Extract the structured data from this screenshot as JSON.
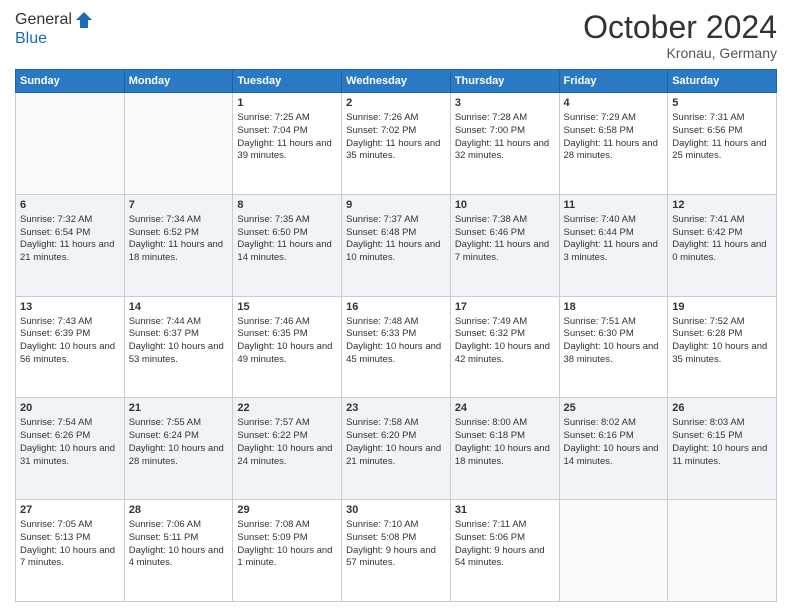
{
  "header": {
    "logo_line1": "General",
    "logo_line2": "Blue",
    "month": "October 2024",
    "location": "Kronau, Germany"
  },
  "days_of_week": [
    "Sunday",
    "Monday",
    "Tuesday",
    "Wednesday",
    "Thursday",
    "Friday",
    "Saturday"
  ],
  "weeks": [
    [
      {
        "day": "",
        "sunrise": "",
        "sunset": "",
        "daylight": ""
      },
      {
        "day": "",
        "sunrise": "",
        "sunset": "",
        "daylight": ""
      },
      {
        "day": "1",
        "sunrise": "Sunrise: 7:25 AM",
        "sunset": "Sunset: 7:04 PM",
        "daylight": "Daylight: 11 hours and 39 minutes."
      },
      {
        "day": "2",
        "sunrise": "Sunrise: 7:26 AM",
        "sunset": "Sunset: 7:02 PM",
        "daylight": "Daylight: 11 hours and 35 minutes."
      },
      {
        "day": "3",
        "sunrise": "Sunrise: 7:28 AM",
        "sunset": "Sunset: 7:00 PM",
        "daylight": "Daylight: 11 hours and 32 minutes."
      },
      {
        "day": "4",
        "sunrise": "Sunrise: 7:29 AM",
        "sunset": "Sunset: 6:58 PM",
        "daylight": "Daylight: 11 hours and 28 minutes."
      },
      {
        "day": "5",
        "sunrise": "Sunrise: 7:31 AM",
        "sunset": "Sunset: 6:56 PM",
        "daylight": "Daylight: 11 hours and 25 minutes."
      }
    ],
    [
      {
        "day": "6",
        "sunrise": "Sunrise: 7:32 AM",
        "sunset": "Sunset: 6:54 PM",
        "daylight": "Daylight: 11 hours and 21 minutes."
      },
      {
        "day": "7",
        "sunrise": "Sunrise: 7:34 AM",
        "sunset": "Sunset: 6:52 PM",
        "daylight": "Daylight: 11 hours and 18 minutes."
      },
      {
        "day": "8",
        "sunrise": "Sunrise: 7:35 AM",
        "sunset": "Sunset: 6:50 PM",
        "daylight": "Daylight: 11 hours and 14 minutes."
      },
      {
        "day": "9",
        "sunrise": "Sunrise: 7:37 AM",
        "sunset": "Sunset: 6:48 PM",
        "daylight": "Daylight: 11 hours and 10 minutes."
      },
      {
        "day": "10",
        "sunrise": "Sunrise: 7:38 AM",
        "sunset": "Sunset: 6:46 PM",
        "daylight": "Daylight: 11 hours and 7 minutes."
      },
      {
        "day": "11",
        "sunrise": "Sunrise: 7:40 AM",
        "sunset": "Sunset: 6:44 PM",
        "daylight": "Daylight: 11 hours and 3 minutes."
      },
      {
        "day": "12",
        "sunrise": "Sunrise: 7:41 AM",
        "sunset": "Sunset: 6:42 PM",
        "daylight": "Daylight: 11 hours and 0 minutes."
      }
    ],
    [
      {
        "day": "13",
        "sunrise": "Sunrise: 7:43 AM",
        "sunset": "Sunset: 6:39 PM",
        "daylight": "Daylight: 10 hours and 56 minutes."
      },
      {
        "day": "14",
        "sunrise": "Sunrise: 7:44 AM",
        "sunset": "Sunset: 6:37 PM",
        "daylight": "Daylight: 10 hours and 53 minutes."
      },
      {
        "day": "15",
        "sunrise": "Sunrise: 7:46 AM",
        "sunset": "Sunset: 6:35 PM",
        "daylight": "Daylight: 10 hours and 49 minutes."
      },
      {
        "day": "16",
        "sunrise": "Sunrise: 7:48 AM",
        "sunset": "Sunset: 6:33 PM",
        "daylight": "Daylight: 10 hours and 45 minutes."
      },
      {
        "day": "17",
        "sunrise": "Sunrise: 7:49 AM",
        "sunset": "Sunset: 6:32 PM",
        "daylight": "Daylight: 10 hours and 42 minutes."
      },
      {
        "day": "18",
        "sunrise": "Sunrise: 7:51 AM",
        "sunset": "Sunset: 6:30 PM",
        "daylight": "Daylight: 10 hours and 38 minutes."
      },
      {
        "day": "19",
        "sunrise": "Sunrise: 7:52 AM",
        "sunset": "Sunset: 6:28 PM",
        "daylight": "Daylight: 10 hours and 35 minutes."
      }
    ],
    [
      {
        "day": "20",
        "sunrise": "Sunrise: 7:54 AM",
        "sunset": "Sunset: 6:26 PM",
        "daylight": "Daylight: 10 hours and 31 minutes."
      },
      {
        "day": "21",
        "sunrise": "Sunrise: 7:55 AM",
        "sunset": "Sunset: 6:24 PM",
        "daylight": "Daylight: 10 hours and 28 minutes."
      },
      {
        "day": "22",
        "sunrise": "Sunrise: 7:57 AM",
        "sunset": "Sunset: 6:22 PM",
        "daylight": "Daylight: 10 hours and 24 minutes."
      },
      {
        "day": "23",
        "sunrise": "Sunrise: 7:58 AM",
        "sunset": "Sunset: 6:20 PM",
        "daylight": "Daylight: 10 hours and 21 minutes."
      },
      {
        "day": "24",
        "sunrise": "Sunrise: 8:00 AM",
        "sunset": "Sunset: 6:18 PM",
        "daylight": "Daylight: 10 hours and 18 minutes."
      },
      {
        "day": "25",
        "sunrise": "Sunrise: 8:02 AM",
        "sunset": "Sunset: 6:16 PM",
        "daylight": "Daylight: 10 hours and 14 minutes."
      },
      {
        "day": "26",
        "sunrise": "Sunrise: 8:03 AM",
        "sunset": "Sunset: 6:15 PM",
        "daylight": "Daylight: 10 hours and 11 minutes."
      }
    ],
    [
      {
        "day": "27",
        "sunrise": "Sunrise: 7:05 AM",
        "sunset": "Sunset: 5:13 PM",
        "daylight": "Daylight: 10 hours and 7 minutes."
      },
      {
        "day": "28",
        "sunrise": "Sunrise: 7:06 AM",
        "sunset": "Sunset: 5:11 PM",
        "daylight": "Daylight: 10 hours and 4 minutes."
      },
      {
        "day": "29",
        "sunrise": "Sunrise: 7:08 AM",
        "sunset": "Sunset: 5:09 PM",
        "daylight": "Daylight: 10 hours and 1 minute."
      },
      {
        "day": "30",
        "sunrise": "Sunrise: 7:10 AM",
        "sunset": "Sunset: 5:08 PM",
        "daylight": "Daylight: 9 hours and 57 minutes."
      },
      {
        "day": "31",
        "sunrise": "Sunrise: 7:11 AM",
        "sunset": "Sunset: 5:06 PM",
        "daylight": "Daylight: 9 hours and 54 minutes."
      },
      {
        "day": "",
        "sunrise": "",
        "sunset": "",
        "daylight": ""
      },
      {
        "day": "",
        "sunrise": "",
        "sunset": "",
        "daylight": ""
      }
    ]
  ]
}
